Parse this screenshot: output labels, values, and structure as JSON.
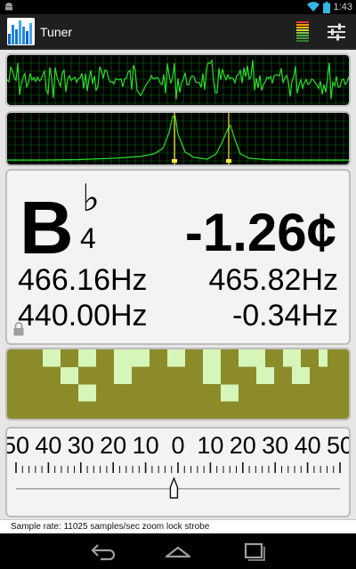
{
  "status_bar": {
    "time": "1:43",
    "icons": [
      "android-icon",
      "wifi-icon",
      "battery-icon"
    ]
  },
  "action_bar": {
    "title": "Tuner",
    "icons": [
      "tuner-app-icon",
      "signal-level-icon",
      "settings-sliders-icon"
    ],
    "level_meter_colors": [
      "#e53935",
      "#ff9800",
      "#ffc107",
      "#cddc39",
      "#8bc34a",
      "#4caf50",
      "#43a047",
      "#2e7d32"
    ]
  },
  "readout": {
    "note_letter": "B",
    "note_accidental": "♭",
    "note_octave": "4",
    "cents": "-1.26¢",
    "measured_frequency": "466.16Hz",
    "reference_frequency": "465.82Hz",
    "reference_a": "440.00Hz",
    "difference": "-0.34Hz",
    "lock_icon": "lock-icon"
  },
  "meter": {
    "labels_left": [
      "50",
      "40",
      "30",
      "20",
      "10"
    ],
    "center_label": "0",
    "labels_right": [
      "10",
      "20",
      "30",
      "40",
      "50"
    ],
    "needle_value": -1.26
  },
  "info": {
    "text": "Sample rate: 11025 samples/sec   zoom lock strobe"
  },
  "colors": {
    "scope_trace": "#27e027",
    "scope_grid": "#0b6b0b",
    "strobe_dark": "#8b8b2a",
    "strobe_light": "#d6f5b8",
    "marker_yellow": "#ffeb3b"
  },
  "nav_bar": {
    "icons": [
      "back-icon",
      "home-icon",
      "recents-icon"
    ]
  }
}
